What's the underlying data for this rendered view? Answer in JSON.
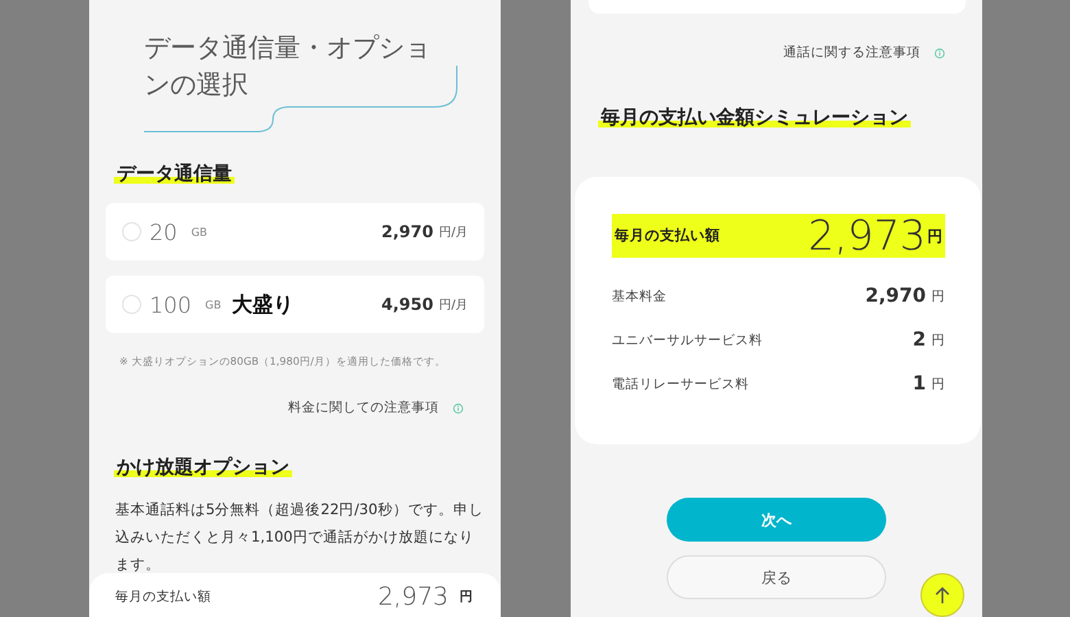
{
  "left_screen": {
    "title": "データ通信量・オプションの選択",
    "data_section": {
      "heading": "データ通信量",
      "options": [
        {
          "amount": "20",
          "unit": "GB",
          "price": "2,970",
          "price_unit": "円/月",
          "selected": false
        },
        {
          "amount": "100",
          "unit": "GB",
          "badge": "大盛り",
          "price": "4,950",
          "price_unit": "円/月",
          "selected": false
        }
      ],
      "note": "※ 大盛りオプションの80GB（1,980円/月）を適用した価格です。",
      "notice_link": "料金に関しての注意事項"
    },
    "call_section": {
      "heading": "かけ放題オプション",
      "description": "基本通話料は5分無料（超過後22円/30秒）です。申し込みいただくと月々1,100円で通話がかけ放題になります。"
    },
    "footer": {
      "label": "毎月の支払い額",
      "amount": "2,973",
      "currency": "円"
    }
  },
  "right_screen": {
    "notice_link": "通話に関する注意事項",
    "simulation": {
      "heading": "毎月の支払い金額シミュレーション",
      "total": {
        "label": "毎月の支払い額",
        "amount": "2,973",
        "currency": "円"
      },
      "rows": [
        {
          "label": "基本料金",
          "amount": "2,970",
          "currency": "円"
        },
        {
          "label": "ユニバーサルサービス料",
          "amount": "2",
          "currency": "円"
        },
        {
          "label": "電話リレーサービス料",
          "amount": "1",
          "currency": "円"
        }
      ]
    },
    "buttons": [
      {
        "label": "次へ",
        "kind": "primary"
      },
      {
        "label": "戻る",
        "kind": "secondary"
      }
    ]
  }
}
